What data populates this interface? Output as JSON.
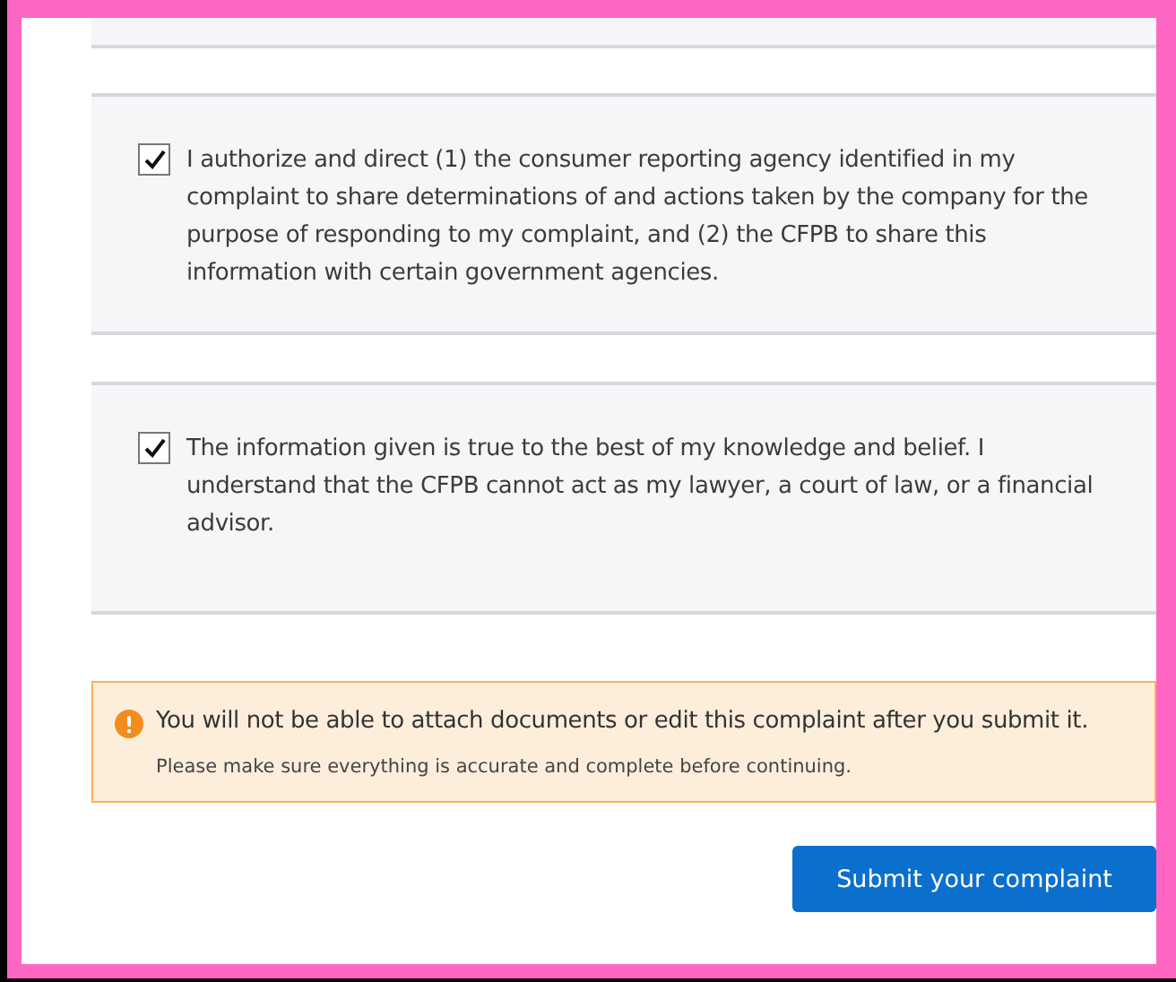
{
  "agreements": [
    {
      "checked": true,
      "text": "I authorize and direct (1) the consumer reporting agency identified in my complaint to share determinations of and actions taken by the company for the purpose of responding to my complaint, and (2) the CFPB to share this information with certain government agencies."
    },
    {
      "checked": true,
      "text": "The information given is true to the best of my knowledge and belief. I understand that the CFPB cannot act as my lawyer, a court of law, or a financial advisor."
    }
  ],
  "warning": {
    "message": "You will not be able to attach documents or edit this complaint after you submit it.",
    "note": "Please make sure everything is accurate and complete before continuing."
  },
  "submit_button": "Submit your complaint"
}
